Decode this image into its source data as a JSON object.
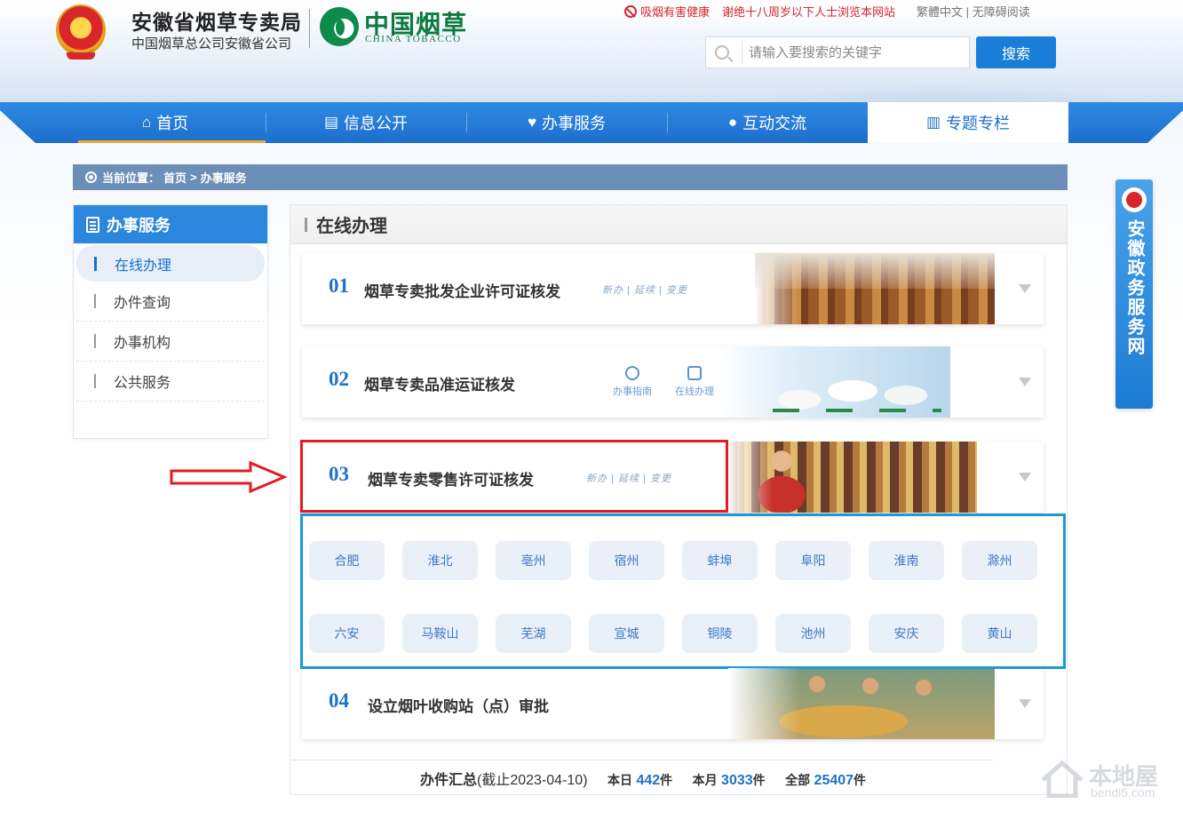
{
  "header": {
    "org_title": "安徽省烟草专卖局",
    "org_subtitle": "中国烟草总公司安徽省公司",
    "brand_cn": "中国烟草",
    "brand_en": "CHINA TOBACCO",
    "notice_health": "吸烟有害健康",
    "notice_minors": "谢绝十八周岁以下人士浏览本网站",
    "lang_traditional": "繁體中文",
    "link_separator": "|",
    "accessibility": "无障碍阅读",
    "search_placeholder": "请输入要搜索的关键字",
    "search_button": "搜索",
    "accent_red": "#d8262a",
    "accent_green": "#0e7a40"
  },
  "nav": {
    "items": [
      {
        "label": "首页",
        "icon": "home-icon"
      },
      {
        "label": "信息公开",
        "icon": "info-icon"
      },
      {
        "label": "办事服务",
        "icon": "heart-icon"
      },
      {
        "label": "互动交流",
        "icon": "chat-icon"
      },
      {
        "label": "专题专栏",
        "icon": "book-icon"
      }
    ],
    "active_index": 4,
    "color": "#1d6fcc"
  },
  "breadcrumb": {
    "prefix": "当前位置：",
    "home": "首页",
    "separator": ">",
    "current": "办事服务"
  },
  "sidebar": {
    "title": "办事服务",
    "items": [
      "在线办理",
      "办件查询",
      "办事机构",
      "公共服务"
    ],
    "active_index": 0
  },
  "panel": {
    "title": "在线办理",
    "services": [
      {
        "num": "01",
        "name": "烟草专卖批发企业许可证核发",
        "tags": "新办 | 延续 | 变更"
      },
      {
        "num": "02",
        "name": "烟草专卖品准运证核发",
        "quick_links": [
          "办事指南",
          "在线办理"
        ]
      },
      {
        "num": "03",
        "name": "烟草专卖零售许可证核发",
        "tags": "新办 | 延续 | 变更"
      },
      {
        "num": "04",
        "name": "设立烟叶收购站（点）审批"
      }
    ],
    "cities": [
      "合肥",
      "淮北",
      "亳州",
      "宿州",
      "蚌埠",
      "阜阳",
      "淮南",
      "滁州",
      "六安",
      "马鞍山",
      "芜湖",
      "宣城",
      "铜陵",
      "池州",
      "安庆",
      "黄山"
    ]
  },
  "summary": {
    "label": "办件汇总",
    "as_of": "(截止2023-04-10)",
    "today_label": "本日",
    "today_value": "442",
    "month_label": "本月",
    "month_value": "3033",
    "total_label": "全部",
    "total_value": "25407",
    "unit": "件"
  },
  "side_banner": {
    "text": "安徽政务服务网"
  },
  "watermark": {
    "title": "本地屋",
    "domain": "bendi5.com"
  },
  "annotations": {
    "highlight_red": "#e31b24",
    "highlight_blue": "#1a9ad8"
  }
}
